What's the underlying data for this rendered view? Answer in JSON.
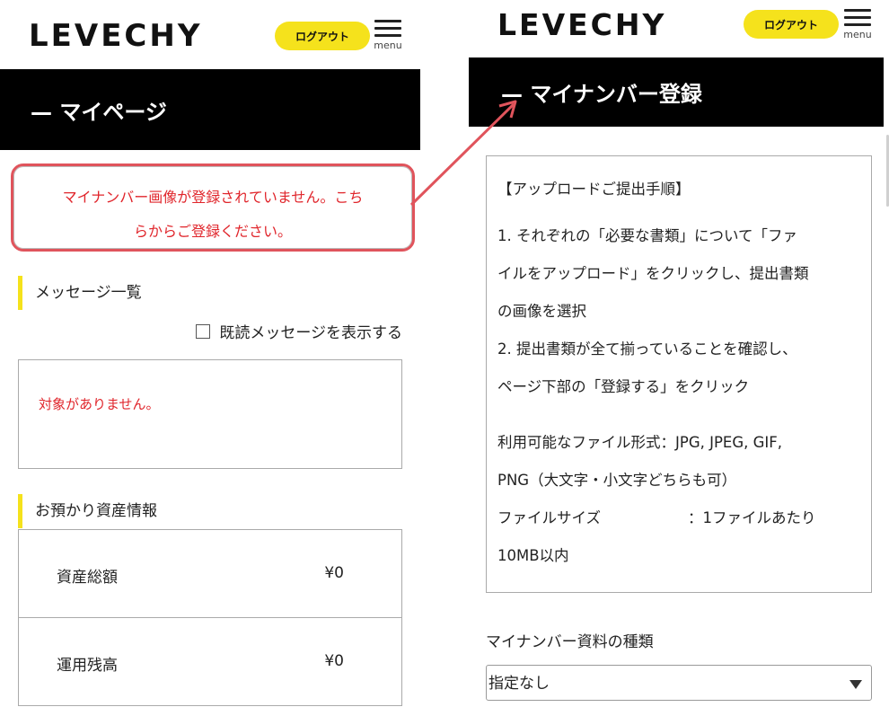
{
  "brand": "LEVECHY",
  "logout_label": "ログアウト",
  "menu_label": "menu",
  "colors": {
    "accent_yellow": "#f5e21c",
    "alert_red": "#e0252b",
    "arrow_red": "#e0545c"
  },
  "left": {
    "page_title": "— マイページ",
    "alert": {
      "line1": "マイナンバー画像が登録されていません。こち",
      "line2": "らからご登録ください。"
    },
    "messages": {
      "heading": "メッセージ一覧",
      "show_read_label": "既読メッセージを表示する",
      "empty_text": "対象がありません。"
    },
    "assets": {
      "heading": "お預かり資産情報",
      "rows": [
        {
          "label": "資産総額",
          "value": "¥0"
        },
        {
          "label": "運用残高",
          "value": "¥0"
        }
      ]
    }
  },
  "right": {
    "page_title": "— マイナンバー登録",
    "instructions": {
      "title": "【アップロードご提出手順】",
      "step1_a": "1. それぞれの「必要な書類」について「ファ",
      "step1_b": "イルをアップロード」をクリックし、提出書類",
      "step1_c": "の画像を選択",
      "step2_a": "2. 提出書類が全て揃っていることを確認し、",
      "step2_b": "ページ下部の「登録する」をクリック",
      "formats_a": "利用可能なファイル形式：JPG, JPEG, GIF,",
      "formats_b": "PNG（大文字・小文字どちらも可）",
      "size_label": "ファイルサイズ",
      "size_value": "：1ファイルあたり",
      "size_value_b": "10MB以内"
    },
    "doc_type": {
      "label": "マイナンバー資料の種類",
      "selected": "指定なし"
    }
  }
}
